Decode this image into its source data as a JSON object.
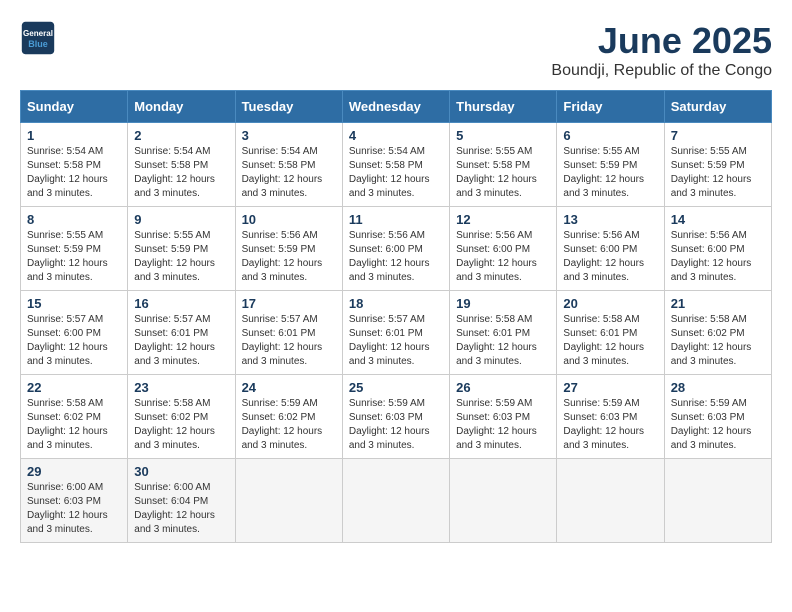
{
  "logo": {
    "line1": "General",
    "line2": "Blue"
  },
  "title": "June 2025",
  "location": "Boundji, Republic of the Congo",
  "headers": [
    "Sunday",
    "Monday",
    "Tuesday",
    "Wednesday",
    "Thursday",
    "Friday",
    "Saturday"
  ],
  "weeks": [
    [
      {
        "day": "1",
        "info": "Sunrise: 5:54 AM\nSunset: 5:58 PM\nDaylight: 12 hours\nand 3 minutes."
      },
      {
        "day": "2",
        "info": "Sunrise: 5:54 AM\nSunset: 5:58 PM\nDaylight: 12 hours\nand 3 minutes."
      },
      {
        "day": "3",
        "info": "Sunrise: 5:54 AM\nSunset: 5:58 PM\nDaylight: 12 hours\nand 3 minutes."
      },
      {
        "day": "4",
        "info": "Sunrise: 5:54 AM\nSunset: 5:58 PM\nDaylight: 12 hours\nand 3 minutes."
      },
      {
        "day": "5",
        "info": "Sunrise: 5:55 AM\nSunset: 5:58 PM\nDaylight: 12 hours\nand 3 minutes."
      },
      {
        "day": "6",
        "info": "Sunrise: 5:55 AM\nSunset: 5:59 PM\nDaylight: 12 hours\nand 3 minutes."
      },
      {
        "day": "7",
        "info": "Sunrise: 5:55 AM\nSunset: 5:59 PM\nDaylight: 12 hours\nand 3 minutes."
      }
    ],
    [
      {
        "day": "8",
        "info": "Sunrise: 5:55 AM\nSunset: 5:59 PM\nDaylight: 12 hours\nand 3 minutes."
      },
      {
        "day": "9",
        "info": "Sunrise: 5:55 AM\nSunset: 5:59 PM\nDaylight: 12 hours\nand 3 minutes."
      },
      {
        "day": "10",
        "info": "Sunrise: 5:56 AM\nSunset: 5:59 PM\nDaylight: 12 hours\nand 3 minutes."
      },
      {
        "day": "11",
        "info": "Sunrise: 5:56 AM\nSunset: 6:00 PM\nDaylight: 12 hours\nand 3 minutes."
      },
      {
        "day": "12",
        "info": "Sunrise: 5:56 AM\nSunset: 6:00 PM\nDaylight: 12 hours\nand 3 minutes."
      },
      {
        "day": "13",
        "info": "Sunrise: 5:56 AM\nSunset: 6:00 PM\nDaylight: 12 hours\nand 3 minutes."
      },
      {
        "day": "14",
        "info": "Sunrise: 5:56 AM\nSunset: 6:00 PM\nDaylight: 12 hours\nand 3 minutes."
      }
    ],
    [
      {
        "day": "15",
        "info": "Sunrise: 5:57 AM\nSunset: 6:00 PM\nDaylight: 12 hours\nand 3 minutes."
      },
      {
        "day": "16",
        "info": "Sunrise: 5:57 AM\nSunset: 6:01 PM\nDaylight: 12 hours\nand 3 minutes."
      },
      {
        "day": "17",
        "info": "Sunrise: 5:57 AM\nSunset: 6:01 PM\nDaylight: 12 hours\nand 3 minutes."
      },
      {
        "day": "18",
        "info": "Sunrise: 5:57 AM\nSunset: 6:01 PM\nDaylight: 12 hours\nand 3 minutes."
      },
      {
        "day": "19",
        "info": "Sunrise: 5:58 AM\nSunset: 6:01 PM\nDaylight: 12 hours\nand 3 minutes."
      },
      {
        "day": "20",
        "info": "Sunrise: 5:58 AM\nSunset: 6:01 PM\nDaylight: 12 hours\nand 3 minutes."
      },
      {
        "day": "21",
        "info": "Sunrise: 5:58 AM\nSunset: 6:02 PM\nDaylight: 12 hours\nand 3 minutes."
      }
    ],
    [
      {
        "day": "22",
        "info": "Sunrise: 5:58 AM\nSunset: 6:02 PM\nDaylight: 12 hours\nand 3 minutes."
      },
      {
        "day": "23",
        "info": "Sunrise: 5:58 AM\nSunset: 6:02 PM\nDaylight: 12 hours\nand 3 minutes."
      },
      {
        "day": "24",
        "info": "Sunrise: 5:59 AM\nSunset: 6:02 PM\nDaylight: 12 hours\nand 3 minutes."
      },
      {
        "day": "25",
        "info": "Sunrise: 5:59 AM\nSunset: 6:03 PM\nDaylight: 12 hours\nand 3 minutes."
      },
      {
        "day": "26",
        "info": "Sunrise: 5:59 AM\nSunset: 6:03 PM\nDaylight: 12 hours\nand 3 minutes."
      },
      {
        "day": "27",
        "info": "Sunrise: 5:59 AM\nSunset: 6:03 PM\nDaylight: 12 hours\nand 3 minutes."
      },
      {
        "day": "28",
        "info": "Sunrise: 5:59 AM\nSunset: 6:03 PM\nDaylight: 12 hours\nand 3 minutes."
      }
    ],
    [
      {
        "day": "29",
        "info": "Sunrise: 6:00 AM\nSunset: 6:03 PM\nDaylight: 12 hours\nand 3 minutes."
      },
      {
        "day": "30",
        "info": "Sunrise: 6:00 AM\nSunset: 6:04 PM\nDaylight: 12 hours\nand 3 minutes."
      },
      {
        "day": "",
        "info": ""
      },
      {
        "day": "",
        "info": ""
      },
      {
        "day": "",
        "info": ""
      },
      {
        "day": "",
        "info": ""
      },
      {
        "day": "",
        "info": ""
      }
    ]
  ]
}
